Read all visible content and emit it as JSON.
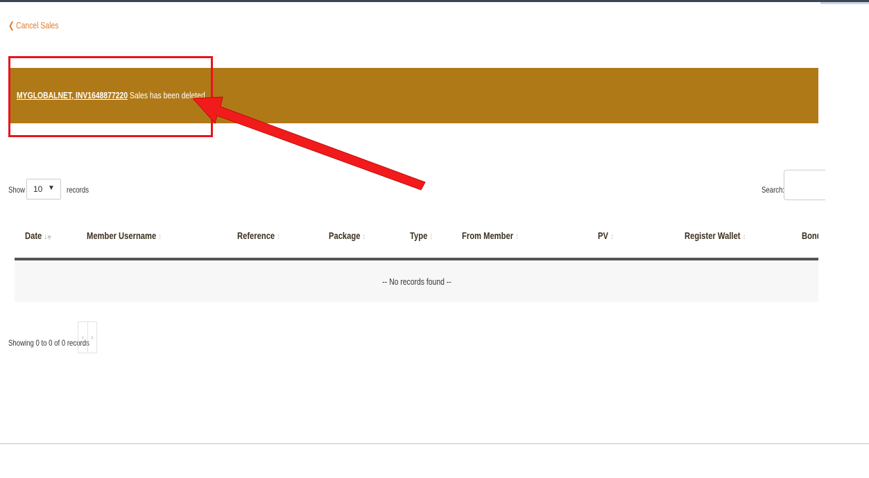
{
  "nav": {
    "back_label": "Cancel Sales"
  },
  "alert": {
    "member": "MYGLOBALNET",
    "invoice": "INV1648877220",
    "message": " Sales has been deleted..",
    "color": "#b07918"
  },
  "annotation_color": "#e8141c",
  "length_control": {
    "show_label": "Show",
    "selected": "10",
    "records_label": "records"
  },
  "search": {
    "label": "Search:",
    "value": ""
  },
  "table": {
    "columns": [
      "Date",
      "Member Username",
      "Reference",
      "Package",
      "Type",
      "From Member",
      "PV",
      "Register Wallet",
      "Bonus"
    ],
    "sorted_column": "Date",
    "empty_message": "-- No records found --"
  },
  "pagination": {
    "info": "Showing 0 to 0 of 0 records",
    "prev": "‹",
    "next": "›"
  }
}
